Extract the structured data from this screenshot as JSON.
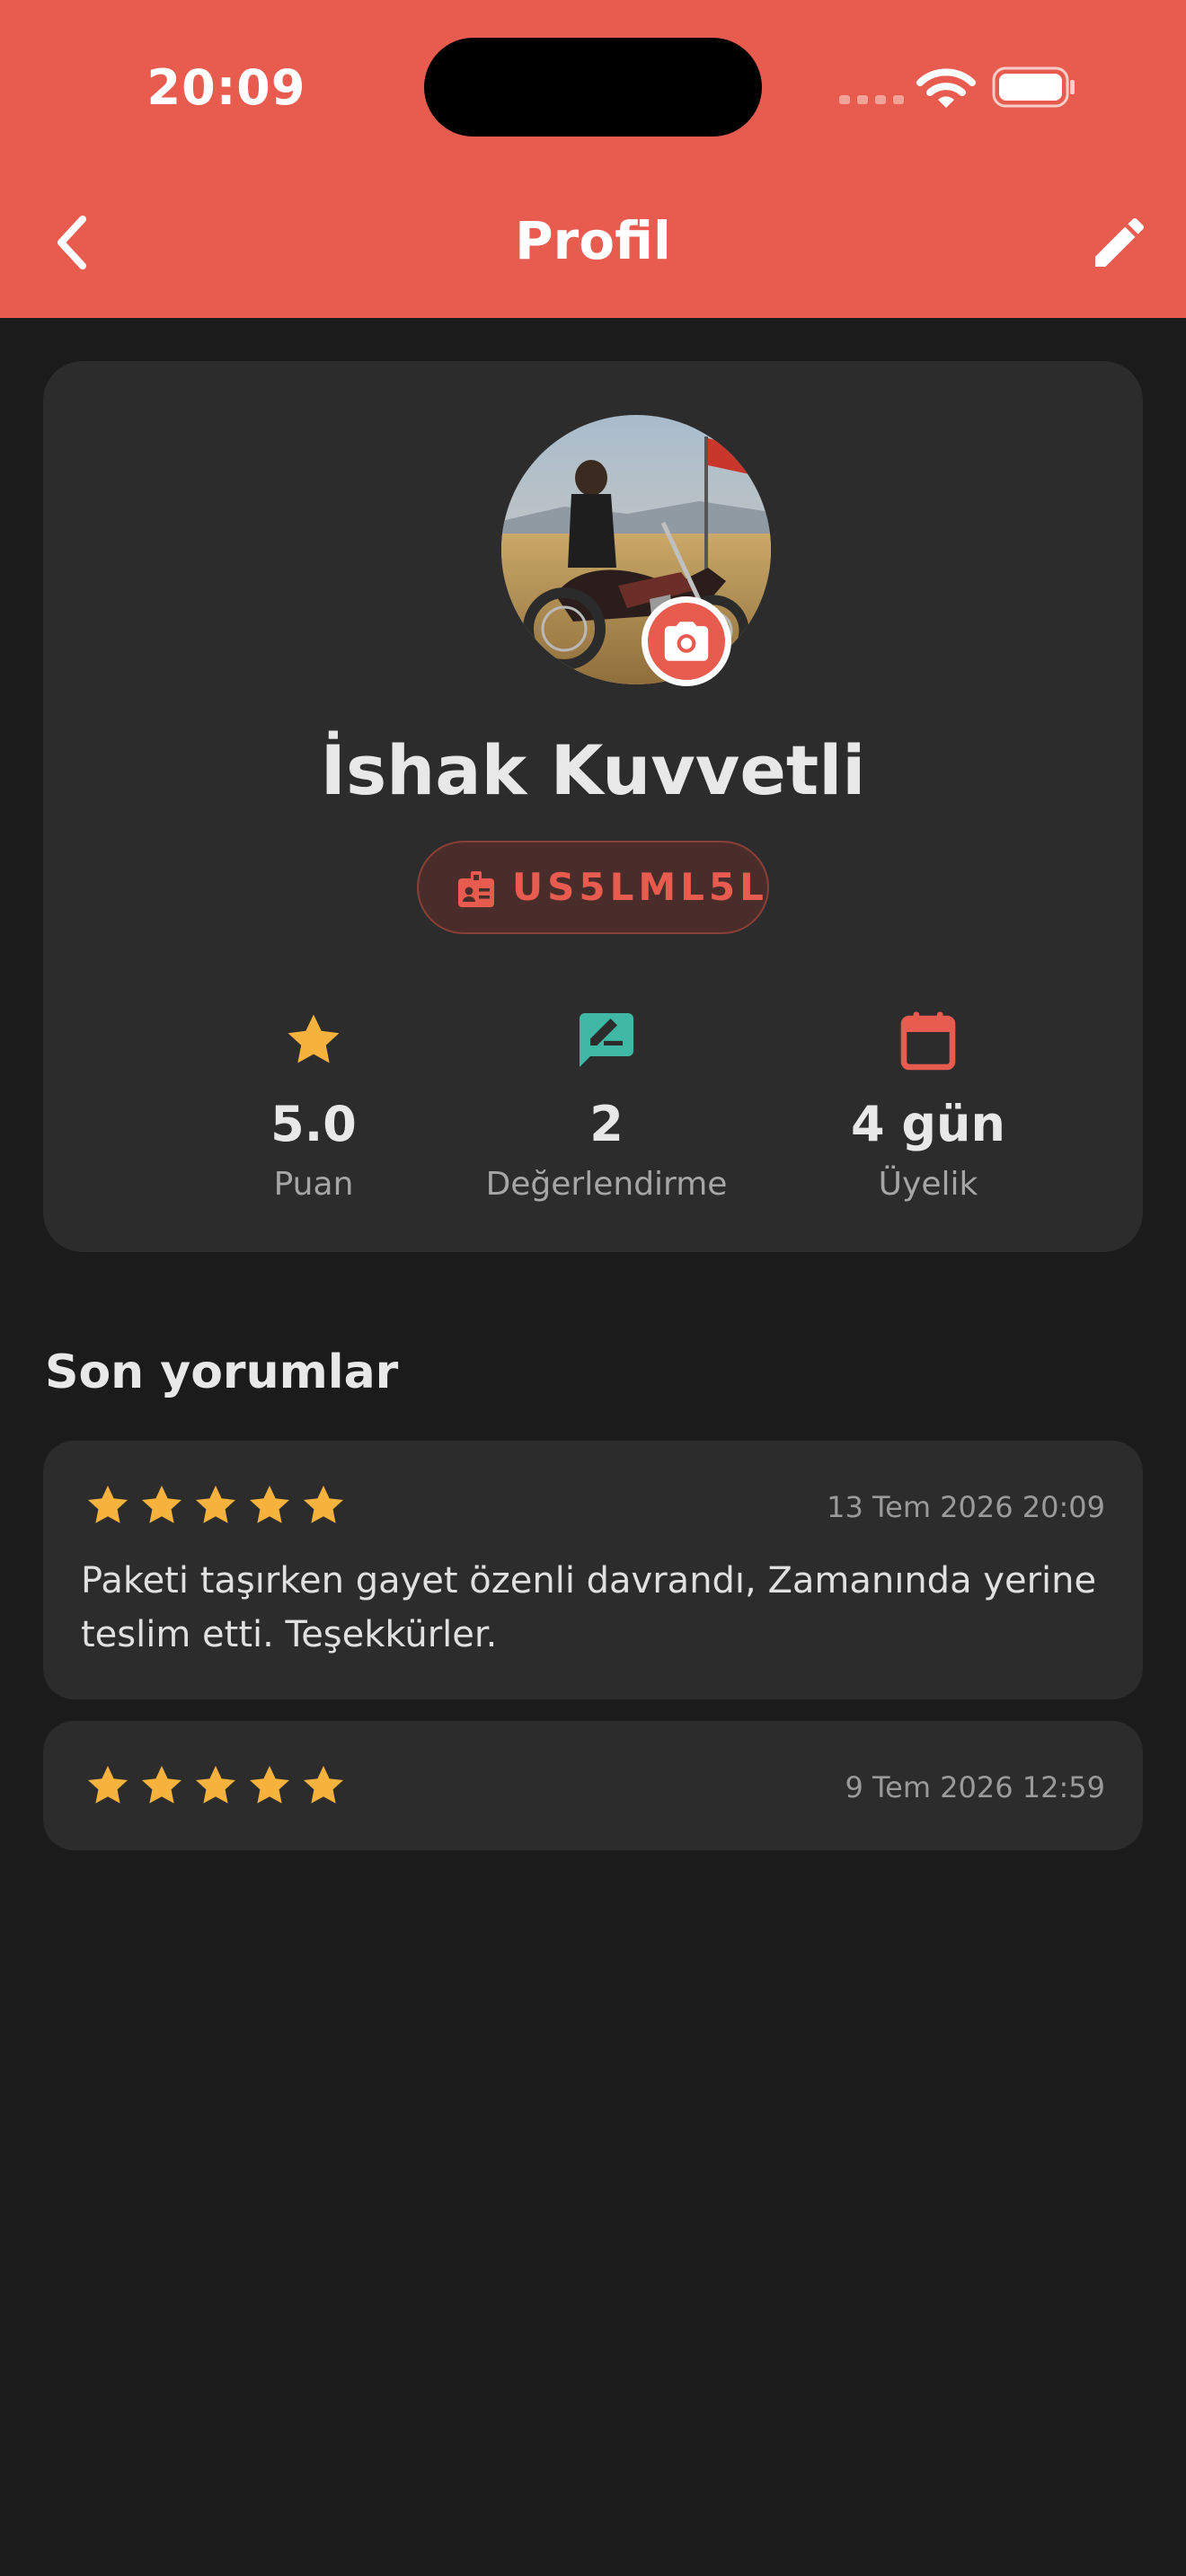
{
  "status_bar": {
    "time": "20:09"
  },
  "header": {
    "title": "Profil"
  },
  "profile": {
    "name": "İshak Kuvvetli",
    "code": "US5LML5L",
    "stats": [
      {
        "icon": "star-icon",
        "value": "5.0",
        "label": "Puan",
        "color": "#f5b23d"
      },
      {
        "icon": "rate-review-icon",
        "value": "2",
        "label": "Değerlendirme",
        "color": "#3fb8a6"
      },
      {
        "icon": "calendar-icon",
        "value": "4 gün",
        "label": "Üyelik",
        "color": "#e85c50"
      }
    ]
  },
  "reviews": {
    "title": "Son yorumlar",
    "items": [
      {
        "rating": 5,
        "date": "13 Tem 2026 20:09",
        "text": "Paketi taşırken gayet özenli davrandı, Zamanında yerine teslim etti. Teşekkürler."
      },
      {
        "rating": 5,
        "date": "9 Tem 2026 12:59",
        "text": ""
      }
    ]
  },
  "colors": {
    "accent": "#e85c50",
    "background": "#1b1b1b",
    "card": "#2c2c2c",
    "star": "#f5b23d"
  }
}
